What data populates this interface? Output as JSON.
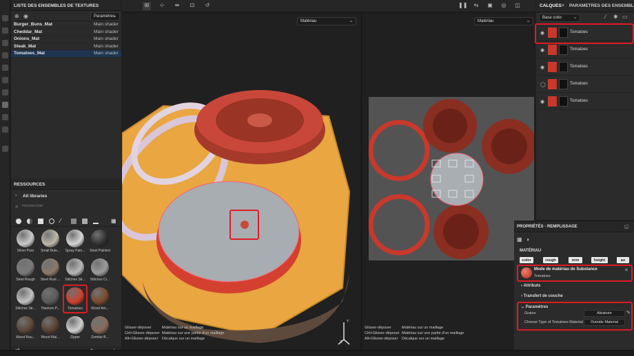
{
  "texture_sets": {
    "title": "LISTE DES ENSEMBLES DE TEXTURES",
    "dropdown": "Paramètres",
    "items": [
      {
        "name": "Burger_Buns_Mat",
        "shader": "Main shader"
      },
      {
        "name": "Cheddar_Mat",
        "shader": "Main shader"
      },
      {
        "name": "Onions_Mat",
        "shader": "Main shader"
      },
      {
        "name": "Steak_Mat",
        "shader": "Main shader"
      },
      {
        "name": "Tomatoes_Mat",
        "shader": "Main shader"
      }
    ]
  },
  "viewports": {
    "left_mode": "Matériau",
    "right_mode": "Matériau",
    "left_hints": [
      {
        "key": "Glisser-déposer",
        "action": "Matériau sur un maillage"
      },
      {
        "key": "Ctrl+Glisser-déposer",
        "action": "Matériau sur une partie d'un maillage"
      },
      {
        "key": "Alt+Glisser-déposer",
        "action": "Décalque sur un maillage"
      }
    ],
    "right_hints": [
      {
        "key": "Glisser-déposer",
        "action": "Matériau sur un maillage"
      },
      {
        "key": "Ctrl+Glisser-déposer",
        "action": "Matériau sur une partie d'un maillage"
      },
      {
        "key": "Alt+Glisser-déposer",
        "action": "Décalque sur un maillage"
      }
    ],
    "axis_labels": {
      "y": "Y",
      "z": "Z"
    }
  },
  "resources": {
    "title": "RESSOURCES",
    "library": "All libraries",
    "search_placeholder": "Rechercher",
    "materials": [
      {
        "label": "Silver Pure",
        "color": "#c9c9c9"
      },
      {
        "label": "Small Bule...",
        "color": "#bdb8a8"
      },
      {
        "label": "Spray Pain...",
        "color": "#d5d5d5"
      },
      {
        "label": "Steel Painted",
        "color": "#2e2e2e"
      },
      {
        "label": "Steel Rough",
        "color": "#7a7a7a"
      },
      {
        "label": "Steel Rust ...",
        "color": "#8a7a6a"
      },
      {
        "label": "Stitches Str...",
        "color": "#b7b7b7"
      },
      {
        "label": "Stitches Cr...",
        "color": "#9c9c9c"
      },
      {
        "label": "Stitches Str...",
        "color": "#c2c2c2"
      },
      {
        "label": "Titanium P...",
        "color": "#5a5a5a"
      },
      {
        "label": "Tomatoes",
        "color": "#d0402c"
      },
      {
        "label": "Wood Am...",
        "color": "#7a4a2e"
      },
      {
        "label": "Wood Rou...",
        "color": "#5a4636"
      },
      {
        "label": "Wood Wal...",
        "color": "#5a4030"
      },
      {
        "label": "Zipper",
        "color": "#cfcfcf"
      },
      {
        "label": "Zombie B...",
        "color": "#8a6a5a"
      }
    ]
  },
  "layers": {
    "tab_active": "CALQUES",
    "tab_other": "PARAMÈTRES DES ENSEMBLES DE",
    "channel": "Base color",
    "items": [
      {
        "name": "Tomatoes"
      },
      {
        "name": "Tomatoes"
      },
      {
        "name": "Tomatoes"
      },
      {
        "name": "Tomatoes"
      },
      {
        "name": "Tomatoes"
      }
    ]
  },
  "properties": {
    "title": "PROPRIÉTÉS - REMPLISSAGE",
    "section_material": "MATÉRIAU",
    "channels": [
      "color",
      "rough",
      "nrm",
      "height",
      "ao"
    ],
    "substance_mode": "Mode de matériau de Substance",
    "substance_name": "Tomatoes",
    "attributes": "Attributs",
    "transfer": "Transfert de couche",
    "parameters": "Paramètres",
    "seed_label": "Graine",
    "seed_value": "Aléatoire",
    "type_label": "Choose Type of Tomatoes Material",
    "type_value": "Outside Material"
  }
}
